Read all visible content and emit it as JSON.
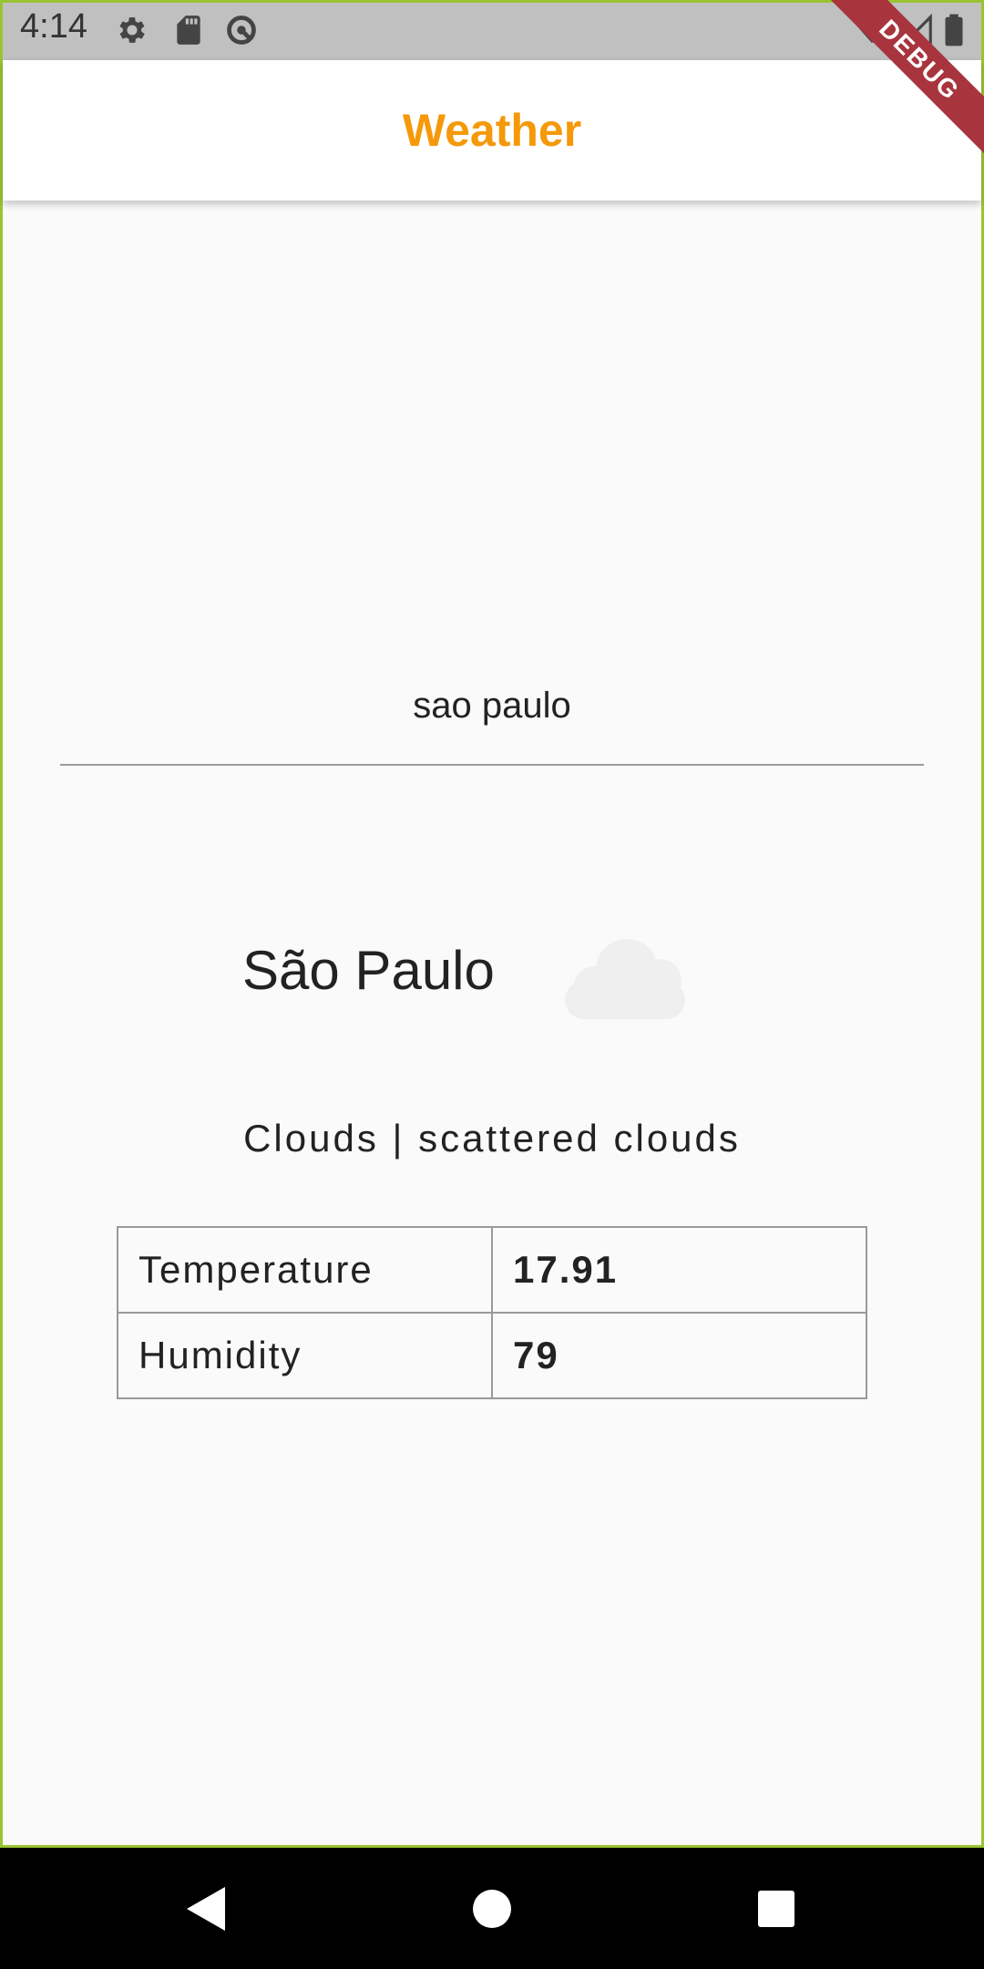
{
  "status_bar": {
    "time": "4:14",
    "left_icons": [
      "gear-icon",
      "sd-card-icon",
      "data-saver-icon"
    ],
    "right_icons": [
      "wifi-icon",
      "cell-signal-icon",
      "battery-icon"
    ]
  },
  "app_bar": {
    "title": "Weather",
    "title_color": "#f5990a"
  },
  "debug_banner": "DEBUG",
  "search": {
    "value": "sao paulo"
  },
  "weather": {
    "city": "São Paulo",
    "icon": "cloud-icon",
    "description": "Clouds | scattered clouds",
    "table": [
      {
        "label": "Temperature",
        "value": "17.91"
      },
      {
        "label": "Humidity",
        "value": "79"
      }
    ]
  },
  "nav_bar": {
    "buttons": [
      "back-icon",
      "home-icon",
      "recents-icon"
    ]
  }
}
